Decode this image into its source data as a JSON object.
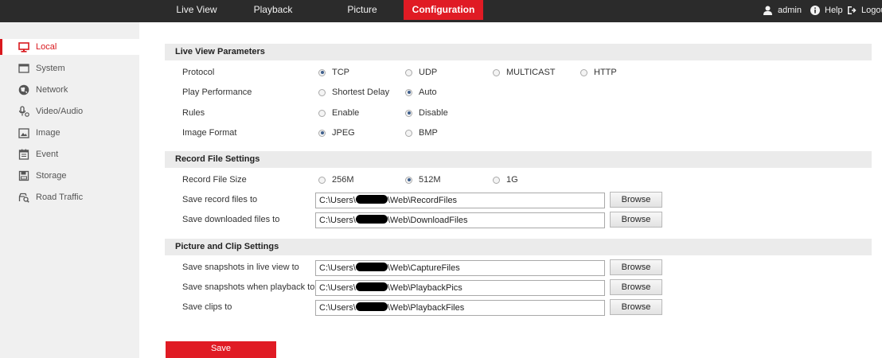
{
  "topnav": {
    "tabs": [
      {
        "label": "Live View"
      },
      {
        "label": "Playback"
      },
      {
        "label": "Picture"
      },
      {
        "label": "Configuration"
      }
    ],
    "user": "admin",
    "help": "Help",
    "logout": "Logout",
    "active_color": "#e01b24"
  },
  "sidebar": {
    "items": [
      {
        "label": "Local",
        "icon": "monitor-icon"
      },
      {
        "label": "System",
        "icon": "window-icon"
      },
      {
        "label": "Network",
        "icon": "globe-icon"
      },
      {
        "label": "Video/Audio",
        "icon": "microphone-icon"
      },
      {
        "label": "Image",
        "icon": "picture-icon"
      },
      {
        "label": "Event",
        "icon": "calendar-icon"
      },
      {
        "label": "Storage",
        "icon": "disk-icon"
      },
      {
        "label": "Road Traffic",
        "icon": "car-search-icon"
      }
    ],
    "active_index": 0
  },
  "live_view": {
    "title": "Live View Parameters",
    "protocol": {
      "label": "Protocol",
      "options": [
        "TCP",
        "UDP",
        "MULTICAST",
        "HTTP"
      ],
      "selected": "TCP"
    },
    "play_performance": {
      "label": "Play Performance",
      "options": [
        "Shortest Delay",
        "Auto"
      ],
      "selected": "Auto"
    },
    "rules": {
      "label": "Rules",
      "options": [
        "Enable",
        "Disable"
      ],
      "selected": "Disable"
    },
    "image_format": {
      "label": "Image Format",
      "options": [
        "JPEG",
        "BMP"
      ],
      "selected": "JPEG"
    }
  },
  "record": {
    "title": "Record File Settings",
    "file_size": {
      "label": "Record File Size",
      "options": [
        "256M",
        "512M",
        "1G"
      ],
      "selected": "512M"
    },
    "save_record": {
      "label": "Save record files to",
      "prefix": "C:\\Users\\",
      "suffix": "\\Web\\RecordFiles"
    },
    "save_downloaded": {
      "label": "Save downloaded files to",
      "prefix": "C:\\Users\\",
      "suffix": "\\Web\\DownloadFiles"
    }
  },
  "picture_clip": {
    "title": "Picture and Clip Settings",
    "snapshots_live": {
      "label": "Save snapshots in live view to",
      "prefix": "C:\\Users\\",
      "suffix": "\\Web\\CaptureFiles"
    },
    "snapshots_playback": {
      "label": "Save snapshots when playback to",
      "prefix": "C:\\Users\\",
      "suffix": "\\Web\\PlaybackPics"
    },
    "clips": {
      "label": "Save clips to",
      "prefix": "C:\\Users\\",
      "suffix": "\\Web\\PlaybackFiles"
    }
  },
  "browse_label": "Browse",
  "save_label": "Save"
}
